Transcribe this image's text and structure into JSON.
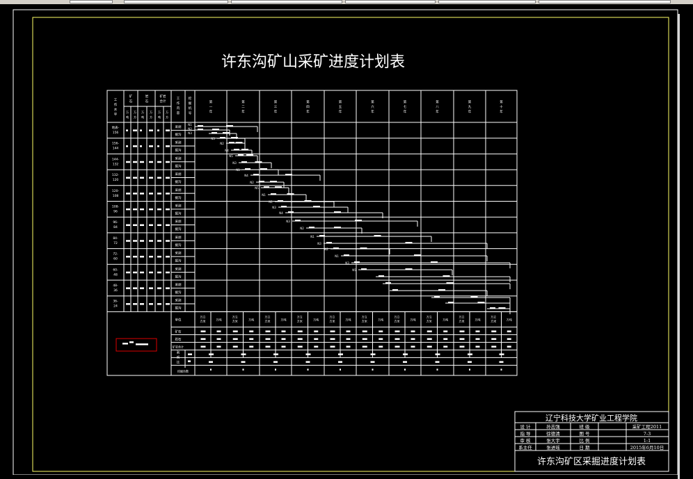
{
  "drawing": {
    "title": "许东沟矿山采矿进度计划表",
    "header": {
      "col1": [
        "工",
        "作",
        "水",
        "平"
      ],
      "col2a": [
        "矿",
        "石"
      ],
      "col2b": [
        "岩",
        "石"
      ],
      "col2c": [
        "矿岩",
        "合计"
      ],
      "sub_wt": [
        "万吨"
      ],
      "sub_fm": [
        "万方"
      ],
      "workcontent": [
        "工",
        "作",
        "内",
        "容"
      ],
      "machine": [
        "挖",
        "掘",
        "机",
        "号"
      ],
      "years": [
        "第一年",
        "第二年",
        "第三年",
        "第四年",
        "第五年",
        "第六年",
        "第七年",
        "第八年",
        "第九年",
        "第十年"
      ]
    },
    "levels": [
      [
        "地表-",
        "156"
      ],
      [
        "156-",
        "144"
      ],
      [
        "144-",
        "132"
      ],
      [
        "132-",
        "120"
      ],
      [
        "120-",
        "108"
      ],
      [
        "108-",
        "96"
      ],
      [
        "96-",
        "84"
      ],
      [
        "84-",
        "72"
      ],
      [
        "72-",
        "60"
      ],
      [
        "60-",
        "48"
      ],
      [
        "48-",
        "36"
      ],
      [
        "36-",
        "24"
      ]
    ],
    "work_types": [
      "采剥",
      "掘沟"
    ],
    "machines_start": [
      "N1",
      "N2",
      "N3"
    ],
    "machine_labels": [
      "N3",
      "N2",
      "N4",
      "N5",
      "N3",
      "N1",
      "N4",
      "N2",
      "N5",
      "N1",
      "N1",
      "N3",
      "N4",
      "N3",
      "N2",
      "N1",
      "N3",
      "N2",
      "N1",
      "N3",
      "N5"
    ],
    "bottom_rows": {
      "unit": "单位",
      "ore": "矿石",
      "rock": "岩石",
      "total": "矿岩合计",
      "strip": [
        "剥",
        "采",
        "比"
      ],
      "excav": "挖掘台数",
      "unit_pair": [
        "万立方米",
        "万吨"
      ]
    }
  },
  "title_block": {
    "school": "辽宁科技大学矿业工程学院",
    "rows": [
      {
        "k1": "设 计",
        "v1": "孙志强",
        "k2": "班 级",
        "v2": "采矿工程2011"
      },
      {
        "k1": "指 导",
        "v1": "徐德清",
        "k2": "图 号",
        "v2": "7-3"
      },
      {
        "k1": "审 核",
        "v1": "张大宇",
        "k2": "比 例",
        "v2": "1:1"
      },
      {
        "k1": "系主任",
        "v1": "张进瑶",
        "k2": "日 期",
        "v2": "2015年6月10日"
      }
    ],
    "drawing_name": "许东沟矿区采掘进度计划表"
  }
}
